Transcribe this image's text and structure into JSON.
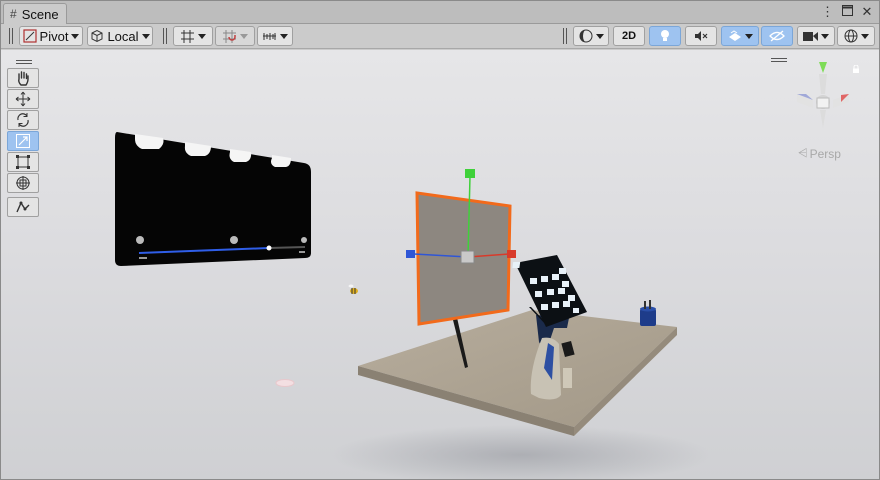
{
  "tab": {
    "title": "Scene",
    "icon": "hash-icon"
  },
  "window_controls": [
    "more-icon",
    "maximize-icon",
    "close-icon"
  ],
  "toolbar": {
    "pivot_label": "Pivot",
    "local_label": "Local",
    "twod_label": "2D"
  },
  "gizmo": {
    "projection_label": "Persp"
  },
  "palette_tools": [
    {
      "name": "hand-tool",
      "active": false
    },
    {
      "name": "move-tool",
      "active": false
    },
    {
      "name": "rotate-tool",
      "active": false
    },
    {
      "name": "scale-tool",
      "active": true
    },
    {
      "name": "rect-tool",
      "active": false
    },
    {
      "name": "transform-tool",
      "active": false
    },
    {
      "name": "custom-tool",
      "active": false
    }
  ],
  "colors": {
    "active_button": "#9ec3f0",
    "selection_outline": "#f26a1b",
    "axis_x": "#d83a2a",
    "axis_y": "#3fd13a",
    "axis_z": "#2f56d6"
  }
}
